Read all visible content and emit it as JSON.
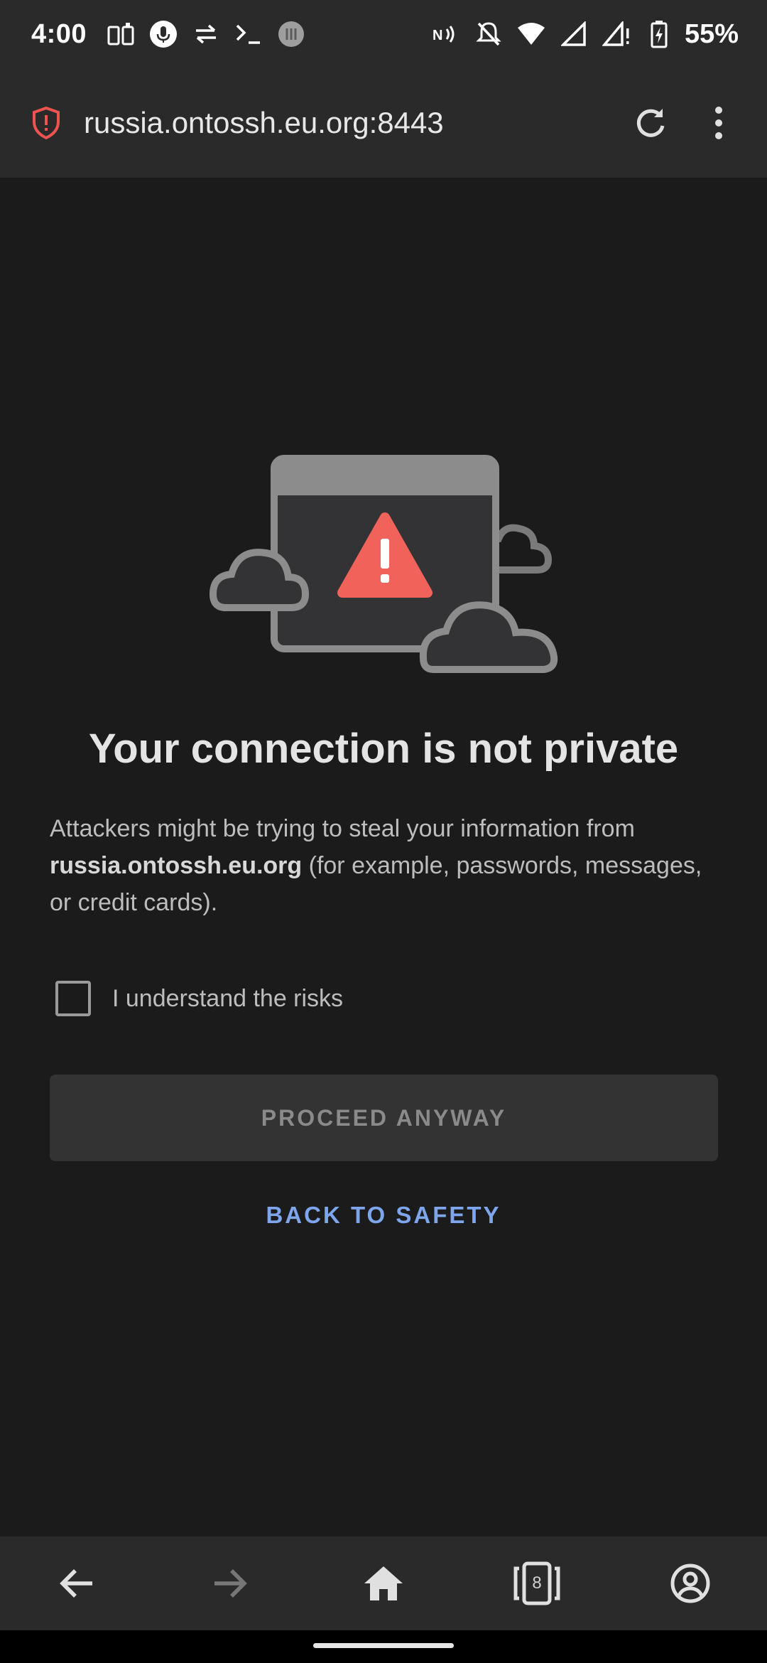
{
  "status_bar": {
    "time": "4:00",
    "battery": "55%",
    "icons": [
      "sim-cards-icon",
      "microphone-icon",
      "data-transfer-icon",
      "terminal-icon",
      "app-icon",
      "nfc-icon",
      "mute-icon",
      "wifi-icon",
      "signal-icon",
      "signal-no-data-icon",
      "battery-charging-icon"
    ]
  },
  "address_bar": {
    "url": "russia.ontossh.eu.org:8443",
    "security_icon": "shield-warning-icon",
    "security_color": "#ef5350"
  },
  "page": {
    "title": "Your connection is not private",
    "body_prefix": "Attackers might be trying to steal your information from ",
    "body_host": "russia.ontossh.eu.org",
    "body_suffix": " (for example, passwords, messages, or credit cards).",
    "checkbox_label": "I understand the risks",
    "checkbox_checked": false,
    "proceed_label": "PROCEED ANYWAY",
    "back_label": "BACK TO SAFETY",
    "accent": "#7ea6ec"
  },
  "toolbar": {
    "tab_count": "8"
  }
}
